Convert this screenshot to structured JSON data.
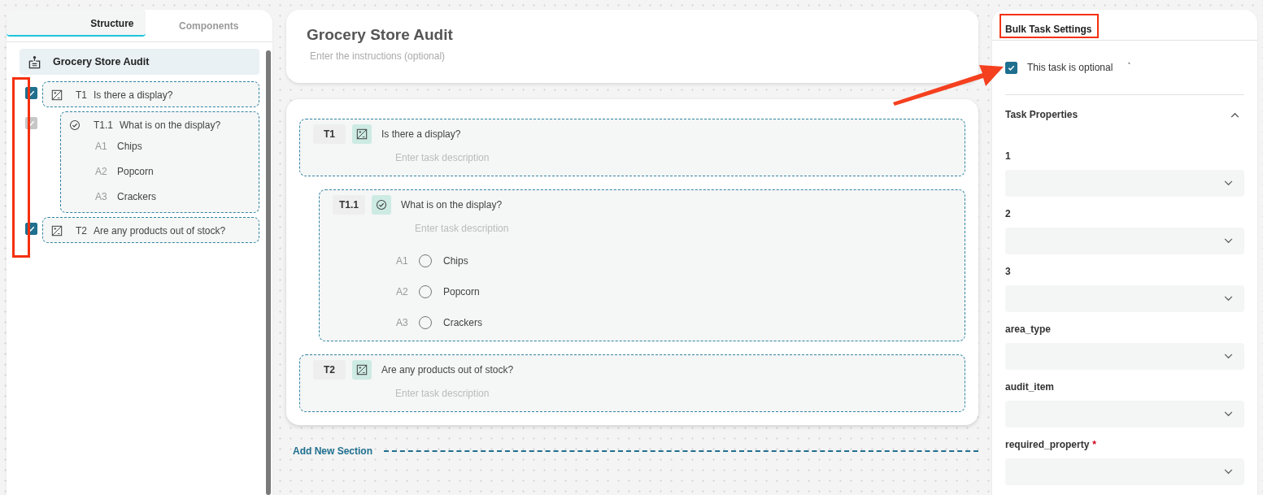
{
  "sidebar": {
    "tabs": [
      {
        "label": "Structure",
        "selected": true
      },
      {
        "label": "Components",
        "selected": false
      }
    ],
    "root": {
      "title": "Grocery Store Audit"
    },
    "tasks": [
      {
        "id": "T1",
        "kind": "photo",
        "title": "Is there a display?",
        "checked": true,
        "disabled": false,
        "children": [
          {
            "id": "T1.1",
            "kind": "choice",
            "title": "What is on the display?",
            "checked": true,
            "disabled": true,
            "answers": [
              {
                "id": "A1",
                "label": "Chips"
              },
              {
                "id": "A2",
                "label": "Popcorn"
              },
              {
                "id": "A3",
                "label": "Crackers"
              }
            ]
          }
        ]
      },
      {
        "id": "T2",
        "kind": "photo",
        "title": "Are any products out of stock?",
        "checked": true,
        "disabled": false
      }
    ]
  },
  "form": {
    "title": "Grocery Store Audit",
    "instructions_placeholder": "Enter the instructions (optional)",
    "tasks": [
      {
        "id": "T1",
        "kind": "photo",
        "title": "Is there a display?",
        "description_placeholder": "Enter task description",
        "children": [
          {
            "id": "T1.1",
            "kind": "choice",
            "title": "What is on the display?",
            "description_placeholder": "Enter task description",
            "answers": [
              {
                "id": "A1",
                "label": "Chips",
                "selected": false
              },
              {
                "id": "A2",
                "label": "Popcorn",
                "selected": false
              },
              {
                "id": "A3",
                "label": "Crackers",
                "selected": false
              }
            ]
          }
        ]
      },
      {
        "id": "T2",
        "kind": "photo",
        "title": "Are any products out of stock?",
        "description_placeholder": "Enter task description"
      }
    ],
    "add_section": "Add New Section"
  },
  "settings": {
    "title": "Bulk Task Settings",
    "optional_label": "This task is optional",
    "optional_mark": "`",
    "optional_checked": true,
    "properties_title": "Task Properties",
    "properties_expanded": true,
    "fields": [
      {
        "label": "1"
      },
      {
        "label": "2"
      },
      {
        "label": "3"
      },
      {
        "label": "area_type"
      },
      {
        "label": "audit_item"
      },
      {
        "label": "required_property",
        "required_mark": "*"
      }
    ]
  }
}
